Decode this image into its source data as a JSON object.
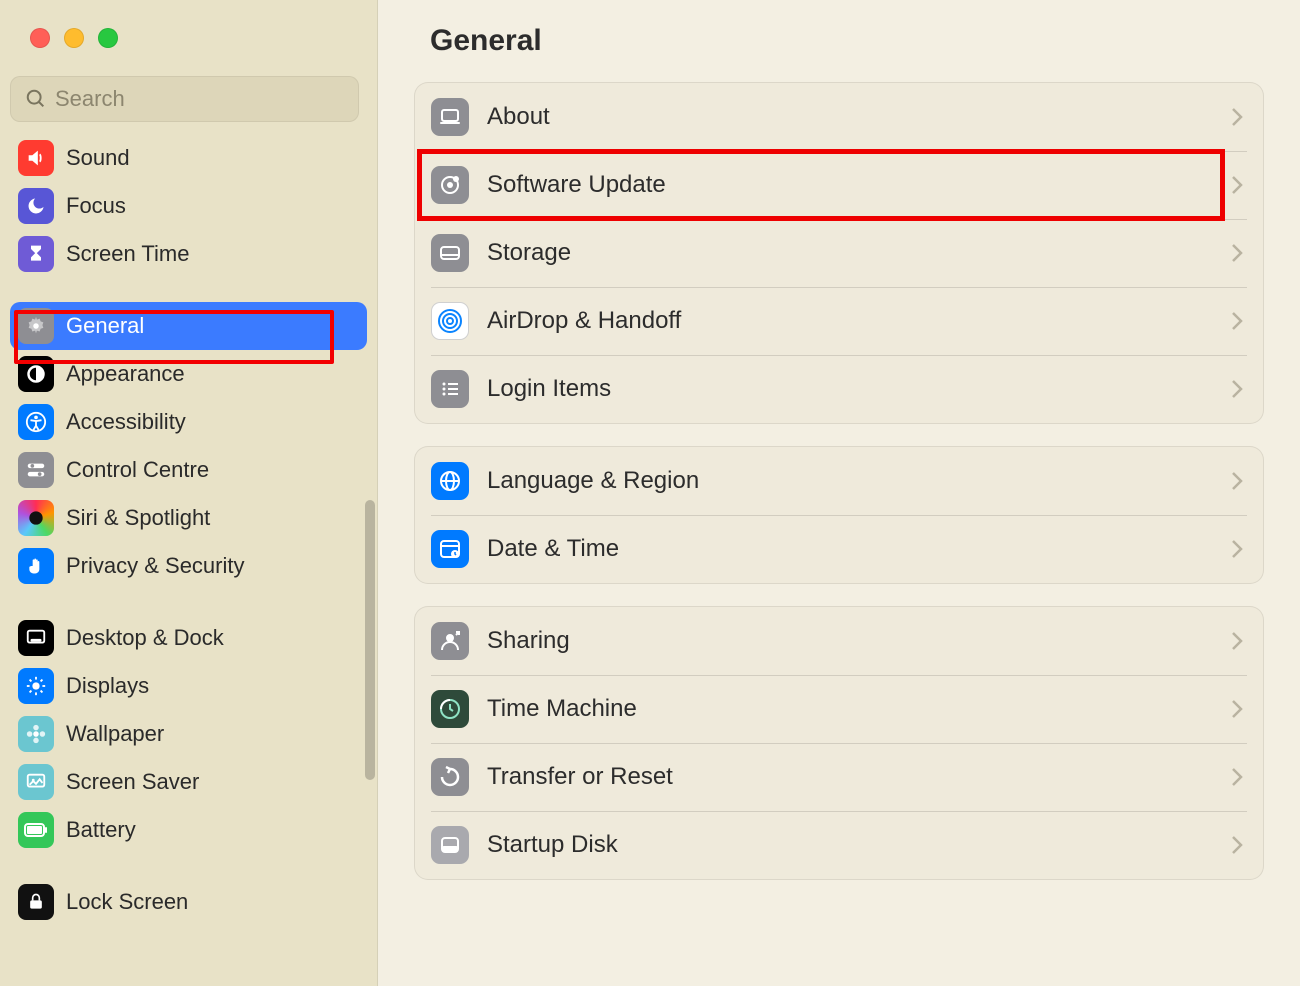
{
  "search": {
    "placeholder": "Search"
  },
  "sidebar": {
    "items": [
      {
        "label": "Sound"
      },
      {
        "label": "Focus"
      },
      {
        "label": "Screen Time"
      },
      {
        "label": "General"
      },
      {
        "label": "Appearance"
      },
      {
        "label": "Accessibility"
      },
      {
        "label": "Control Centre"
      },
      {
        "label": "Siri & Spotlight"
      },
      {
        "label": "Privacy & Security"
      },
      {
        "label": "Desktop & Dock"
      },
      {
        "label": "Displays"
      },
      {
        "label": "Wallpaper"
      },
      {
        "label": "Screen Saver"
      },
      {
        "label": "Battery"
      },
      {
        "label": "Lock Screen"
      }
    ]
  },
  "content": {
    "title": "General",
    "groups": [
      {
        "rows": [
          {
            "label": "About"
          },
          {
            "label": "Software Update"
          },
          {
            "label": "Storage"
          },
          {
            "label": "AirDrop & Handoff"
          },
          {
            "label": "Login Items"
          }
        ]
      },
      {
        "rows": [
          {
            "label": "Language & Region"
          },
          {
            "label": "Date & Time"
          }
        ]
      },
      {
        "rows": [
          {
            "label": "Sharing"
          },
          {
            "label": "Time Machine"
          },
          {
            "label": "Transfer or Reset"
          },
          {
            "label": "Startup Disk"
          }
        ]
      }
    ]
  }
}
